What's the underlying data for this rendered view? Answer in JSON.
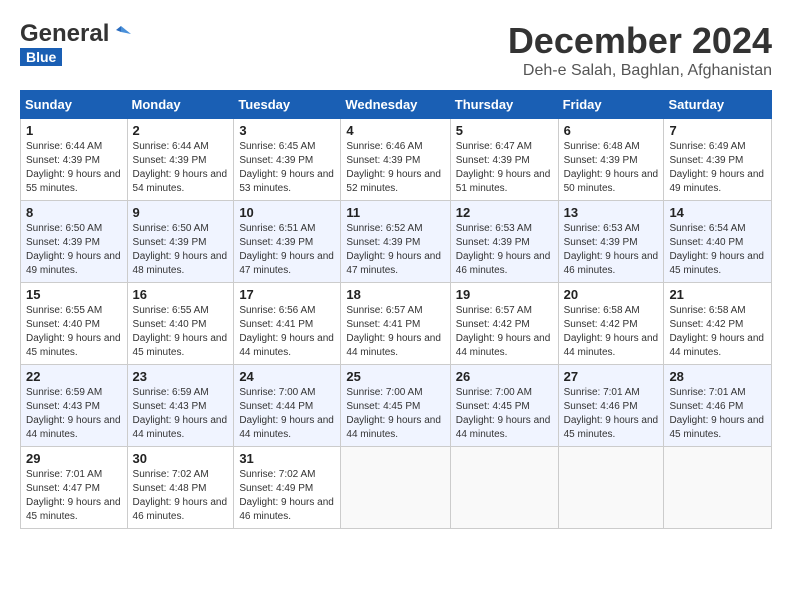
{
  "logo": {
    "general": "General",
    "blue": "Blue"
  },
  "title": "December 2024",
  "location": "Deh-e Salah, Baghlan, Afghanistan",
  "days_header": [
    "Sunday",
    "Monday",
    "Tuesday",
    "Wednesday",
    "Thursday",
    "Friday",
    "Saturday"
  ],
  "weeks": [
    [
      {
        "day": "1",
        "sunrise": "6:44 AM",
        "sunset": "4:39 PM",
        "daylight": "9 hours and 55 minutes."
      },
      {
        "day": "2",
        "sunrise": "6:44 AM",
        "sunset": "4:39 PM",
        "daylight": "9 hours and 54 minutes."
      },
      {
        "day": "3",
        "sunrise": "6:45 AM",
        "sunset": "4:39 PM",
        "daylight": "9 hours and 53 minutes."
      },
      {
        "day": "4",
        "sunrise": "6:46 AM",
        "sunset": "4:39 PM",
        "daylight": "9 hours and 52 minutes."
      },
      {
        "day": "5",
        "sunrise": "6:47 AM",
        "sunset": "4:39 PM",
        "daylight": "9 hours and 51 minutes."
      },
      {
        "day": "6",
        "sunrise": "6:48 AM",
        "sunset": "4:39 PM",
        "daylight": "9 hours and 50 minutes."
      },
      {
        "day": "7",
        "sunrise": "6:49 AM",
        "sunset": "4:39 PM",
        "daylight": "9 hours and 49 minutes."
      }
    ],
    [
      {
        "day": "8",
        "sunrise": "6:50 AM",
        "sunset": "4:39 PM",
        "daylight": "9 hours and 49 minutes."
      },
      {
        "day": "9",
        "sunrise": "6:50 AM",
        "sunset": "4:39 PM",
        "daylight": "9 hours and 48 minutes."
      },
      {
        "day": "10",
        "sunrise": "6:51 AM",
        "sunset": "4:39 PM",
        "daylight": "9 hours and 47 minutes."
      },
      {
        "day": "11",
        "sunrise": "6:52 AM",
        "sunset": "4:39 PM",
        "daylight": "9 hours and 47 minutes."
      },
      {
        "day": "12",
        "sunrise": "6:53 AM",
        "sunset": "4:39 PM",
        "daylight": "9 hours and 46 minutes."
      },
      {
        "day": "13",
        "sunrise": "6:53 AM",
        "sunset": "4:39 PM",
        "daylight": "9 hours and 46 minutes."
      },
      {
        "day": "14",
        "sunrise": "6:54 AM",
        "sunset": "4:40 PM",
        "daylight": "9 hours and 45 minutes."
      }
    ],
    [
      {
        "day": "15",
        "sunrise": "6:55 AM",
        "sunset": "4:40 PM",
        "daylight": "9 hours and 45 minutes."
      },
      {
        "day": "16",
        "sunrise": "6:55 AM",
        "sunset": "4:40 PM",
        "daylight": "9 hours and 45 minutes."
      },
      {
        "day": "17",
        "sunrise": "6:56 AM",
        "sunset": "4:41 PM",
        "daylight": "9 hours and 44 minutes."
      },
      {
        "day": "18",
        "sunrise": "6:57 AM",
        "sunset": "4:41 PM",
        "daylight": "9 hours and 44 minutes."
      },
      {
        "day": "19",
        "sunrise": "6:57 AM",
        "sunset": "4:42 PM",
        "daylight": "9 hours and 44 minutes."
      },
      {
        "day": "20",
        "sunrise": "6:58 AM",
        "sunset": "4:42 PM",
        "daylight": "9 hours and 44 minutes."
      },
      {
        "day": "21",
        "sunrise": "6:58 AM",
        "sunset": "4:42 PM",
        "daylight": "9 hours and 44 minutes."
      }
    ],
    [
      {
        "day": "22",
        "sunrise": "6:59 AM",
        "sunset": "4:43 PM",
        "daylight": "9 hours and 44 minutes."
      },
      {
        "day": "23",
        "sunrise": "6:59 AM",
        "sunset": "4:43 PM",
        "daylight": "9 hours and 44 minutes."
      },
      {
        "day": "24",
        "sunrise": "7:00 AM",
        "sunset": "4:44 PM",
        "daylight": "9 hours and 44 minutes."
      },
      {
        "day": "25",
        "sunrise": "7:00 AM",
        "sunset": "4:45 PM",
        "daylight": "9 hours and 44 minutes."
      },
      {
        "day": "26",
        "sunrise": "7:00 AM",
        "sunset": "4:45 PM",
        "daylight": "9 hours and 44 minutes."
      },
      {
        "day": "27",
        "sunrise": "7:01 AM",
        "sunset": "4:46 PM",
        "daylight": "9 hours and 45 minutes."
      },
      {
        "day": "28",
        "sunrise": "7:01 AM",
        "sunset": "4:46 PM",
        "daylight": "9 hours and 45 minutes."
      }
    ],
    [
      {
        "day": "29",
        "sunrise": "7:01 AM",
        "sunset": "4:47 PM",
        "daylight": "9 hours and 45 minutes."
      },
      {
        "day": "30",
        "sunrise": "7:02 AM",
        "sunset": "4:48 PM",
        "daylight": "9 hours and 46 minutes."
      },
      {
        "day": "31",
        "sunrise": "7:02 AM",
        "sunset": "4:49 PM",
        "daylight": "9 hours and 46 minutes."
      },
      null,
      null,
      null,
      null
    ]
  ]
}
